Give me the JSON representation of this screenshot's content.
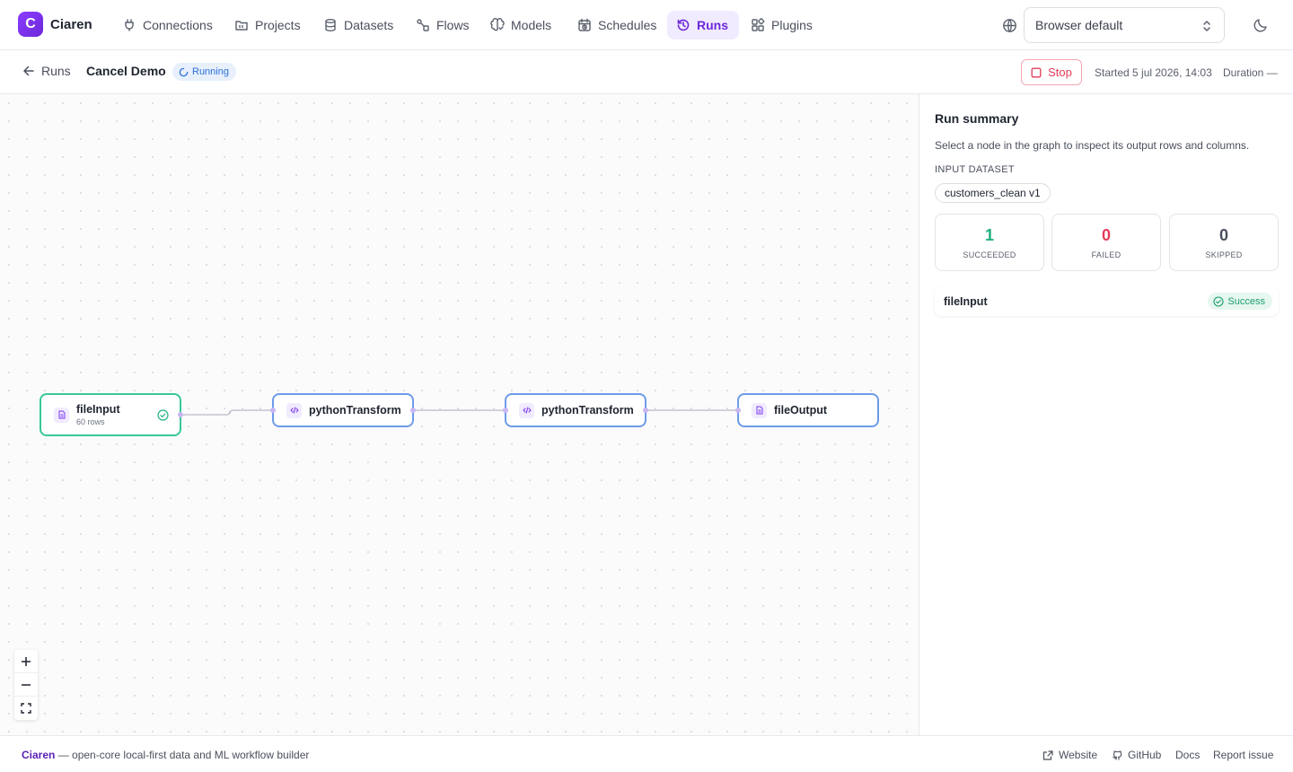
{
  "app": {
    "logo_letter": "C",
    "name": "Ciaren",
    "accent": "#6d28d9"
  },
  "nav": {
    "items": [
      {
        "label": "Connections",
        "icon": "plug-icon",
        "active": false
      },
      {
        "label": "Projects",
        "icon": "folder-icon",
        "active": false
      },
      {
        "label": "Datasets",
        "icon": "database-icon",
        "active": false
      },
      {
        "label": "Flows",
        "icon": "flow-icon",
        "active": false
      },
      {
        "label": "Models",
        "icon": "brain-icon",
        "active": false
      },
      {
        "label": "Schedules",
        "icon": "calendar-clock-icon",
        "active": false
      },
      {
        "label": "Runs",
        "icon": "history-icon",
        "active": true
      },
      {
        "label": "Plugins",
        "icon": "puzzle-icon",
        "active": false
      }
    ],
    "language_value": "Browser default"
  },
  "run": {
    "back_label": "Runs",
    "title": "Cancel Demo",
    "status": "Running",
    "stop_label": "Stop",
    "started": "Started 5 jul 2026, 14:03",
    "duration": "Duration —"
  },
  "graph": {
    "nodes": [
      {
        "label": "fileInput",
        "sublabel": "60 rows",
        "icon": "file-icon",
        "state": "success"
      },
      {
        "label": "pythonTransform",
        "sublabel": "",
        "icon": "code-icon",
        "state": "pending"
      },
      {
        "label": "pythonTransform",
        "sublabel": "",
        "icon": "code-icon",
        "state": "pending"
      },
      {
        "label": "fileOutput",
        "sublabel": "",
        "icon": "file-icon",
        "state": "pending"
      }
    ]
  },
  "summary": {
    "title": "Run summary",
    "description": "Select a node in the graph to inspect its output rows and columns.",
    "input_dataset_label": "INPUT DATASET",
    "input_dataset": "customers_clean v1",
    "stats": [
      {
        "value": "1",
        "label": "SUCCEEDED",
        "color": "#1fae7d"
      },
      {
        "value": "0",
        "label": "FAILED",
        "color": "#e23c5a"
      },
      {
        "value": "0",
        "label": "SKIPPED",
        "color": "#4a4f5c"
      }
    ],
    "node_results": [
      {
        "name": "fileInput",
        "status": "Success"
      }
    ]
  },
  "footer": {
    "brand": "Ciaren",
    "tagline": " — open-core local-first data and ML workflow builder",
    "links": [
      "Website",
      "GitHub",
      "Docs",
      "Report issue"
    ]
  }
}
